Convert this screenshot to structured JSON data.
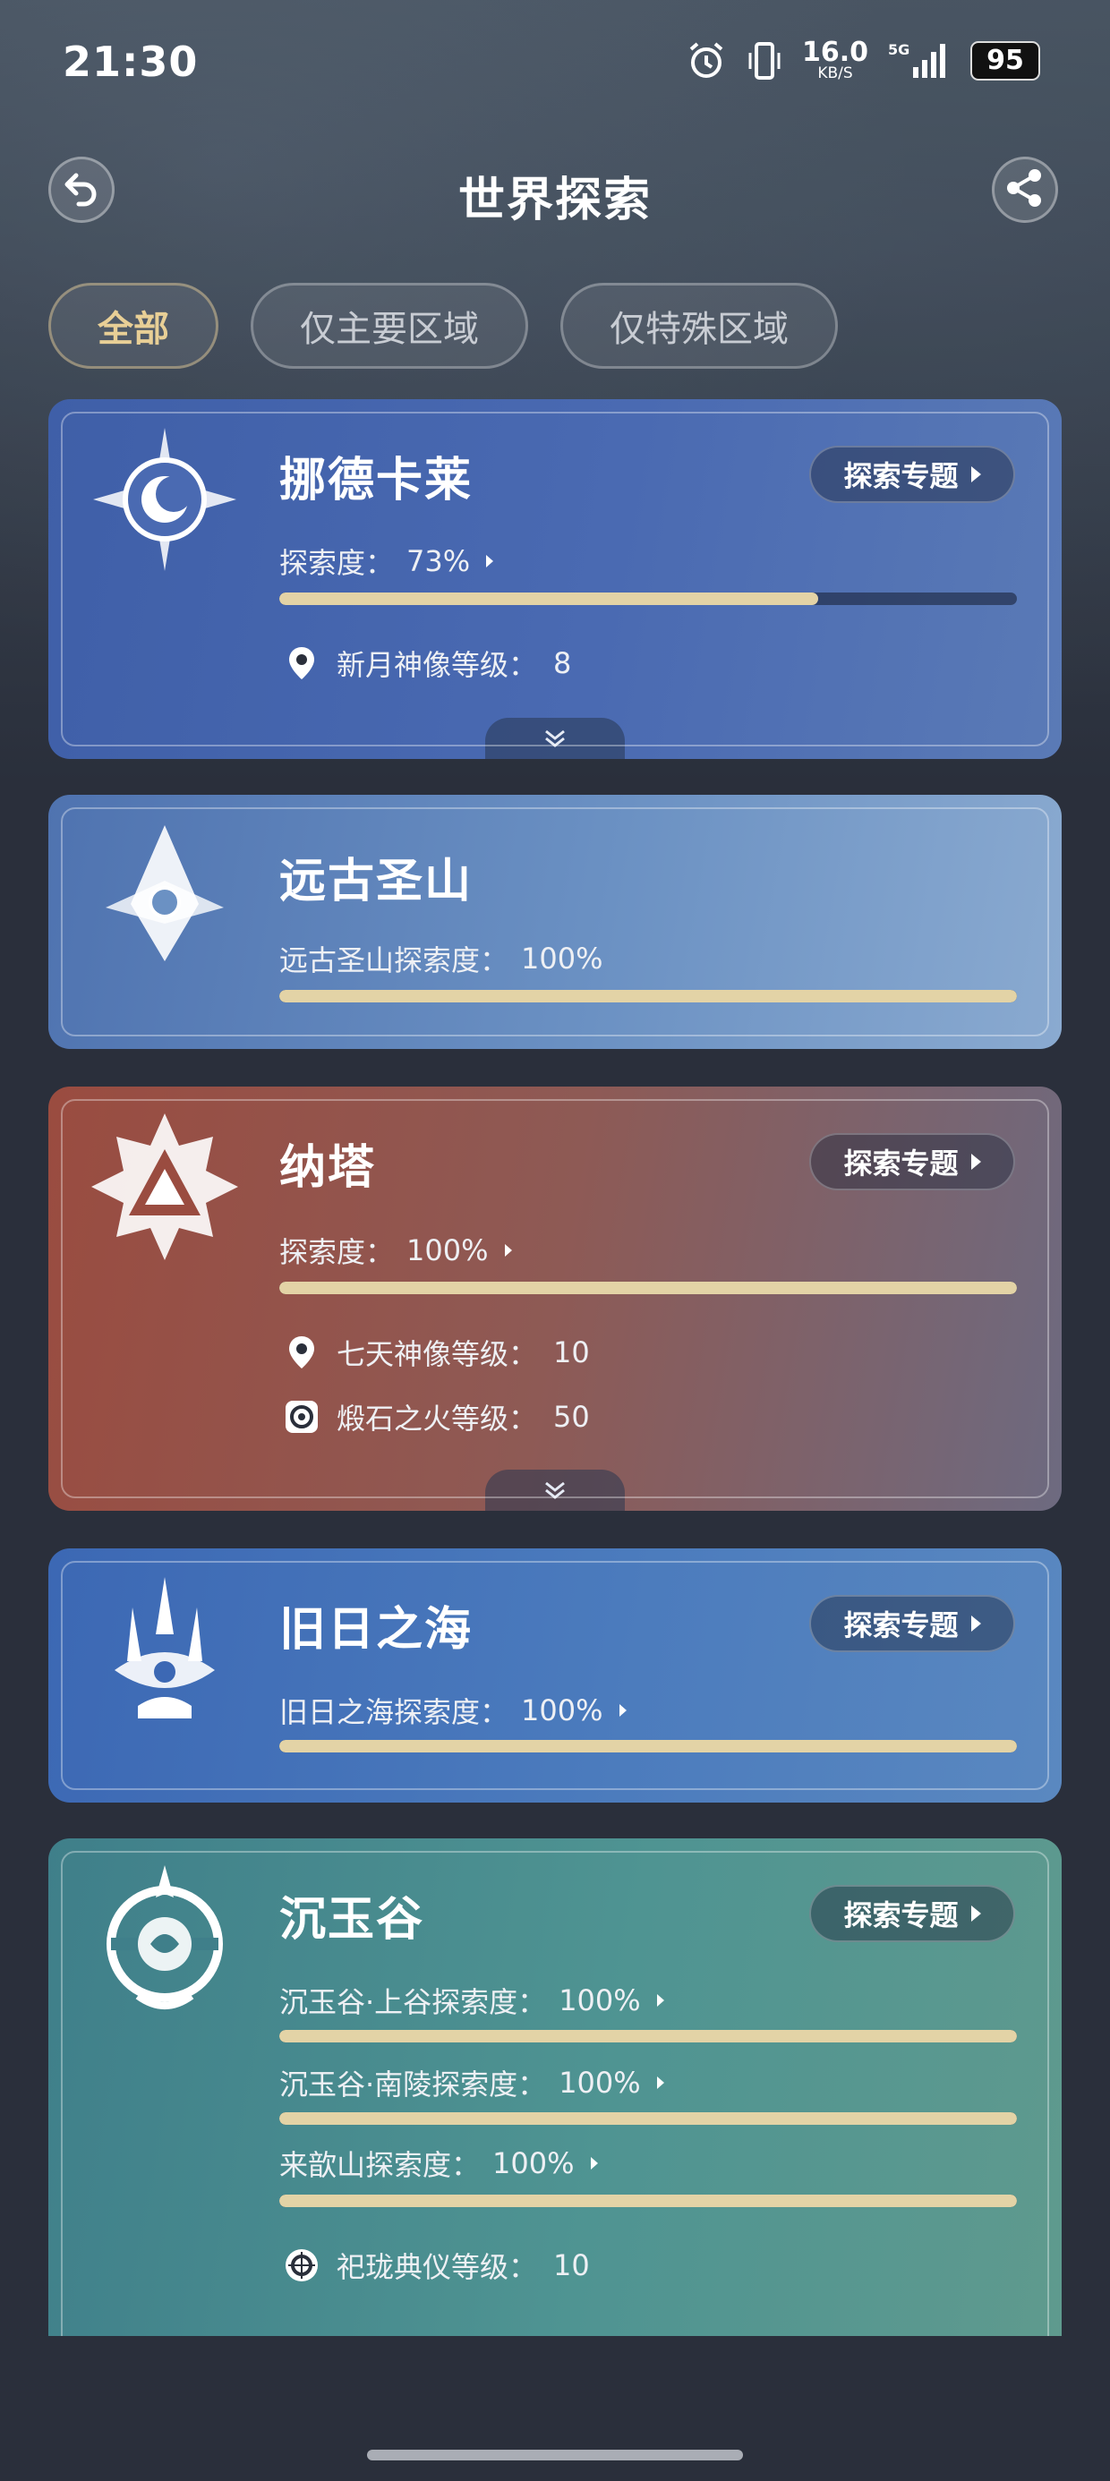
{
  "status_bar": {
    "time": "21:30",
    "net_speed_value": "16.0",
    "net_speed_unit": "KB/S",
    "network_label": "5G",
    "battery": "95",
    "icons": [
      "alarm-icon",
      "vibrate-icon",
      "signal-icon"
    ]
  },
  "header": {
    "title": "世界探索",
    "back_icon": "back-arrow-icon",
    "share_icon": "share-icon"
  },
  "filters": [
    {
      "label": "全部",
      "active": true
    },
    {
      "label": "仅主要区域",
      "active": false
    },
    {
      "label": "仅特殊区域",
      "active": false
    }
  ],
  "regions": [
    {
      "name": "挪德卡莱",
      "topic_button": "探索专题",
      "explore_label": "探索度：",
      "explore_value": "73%",
      "progress": 0.73,
      "levels": [
        {
          "icon": "location-pin-icon",
          "label": "新月神像等级：",
          "value": "8"
        }
      ],
      "color": "#3f5fa8"
    },
    {
      "name": "远古圣山",
      "explore_label": "远古圣山探索度：",
      "explore_value": "100%",
      "progress": 1.0,
      "color": "#6b91c3"
    },
    {
      "name": "纳塔",
      "topic_button": "探索专题",
      "explore_label": "探索度：",
      "explore_value": "100%",
      "progress": 1.0,
      "levels": [
        {
          "icon": "location-pin-icon",
          "label": "七天神像等级：",
          "value": "10"
        },
        {
          "icon": "flame-stone-icon",
          "label": "煅石之火等级：",
          "value": "50"
        }
      ],
      "color": "#9a4c40"
    },
    {
      "name": "旧日之海",
      "topic_button": "探索专题",
      "explore_label": "旧日之海探索度：",
      "explore_value": "100%",
      "progress": 1.0,
      "color": "#3c68b4"
    },
    {
      "name": "沉玉谷",
      "topic_button": "探索专题",
      "subregions": [
        {
          "label": "沉玉谷·上谷探索度：",
          "value": "100%",
          "progress": 1.0
        },
        {
          "label": "沉玉谷·南陵探索度：",
          "value": "100%",
          "progress": 1.0
        },
        {
          "label": "来歆山探索度：",
          "value": "100%",
          "progress": 1.0
        }
      ],
      "levels": [
        {
          "icon": "ritual-icon",
          "label": "祀珑典仪等级：",
          "value": "10"
        }
      ],
      "color": "#3f7f8a"
    }
  ],
  "colors": {
    "background": "#2a2f3b",
    "progress_fill": "#e3d3a6",
    "active_chip": "#e8cf96"
  }
}
